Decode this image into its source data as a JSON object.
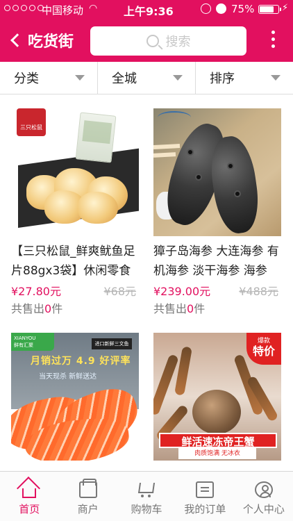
{
  "status_bar": {
    "carrier": "中国移动",
    "time": "上午9:36",
    "battery_pct": "75%"
  },
  "header": {
    "title": "吃货街",
    "search_placeholder": "搜索"
  },
  "filters": [
    {
      "label": "分类"
    },
    {
      "label": "全城"
    },
    {
      "label": "排序"
    }
  ],
  "products": [
    {
      "title": "【三只松鼠_鲜爽鱿鱼足片88gx3袋】休闲零食",
      "price": "¥27.80元",
      "old_price": "¥68元",
      "sold_prefix": "共售出",
      "sold_count": "0",
      "sold_suffix": "件",
      "image_text": "三只松鼠"
    },
    {
      "title": "獐子岛海参 大连海参 有机海参 淡干海参 海参",
      "price": "¥239.00元",
      "old_price": "¥488元",
      "sold_prefix": "共售出",
      "sold_count": "0",
      "sold_suffix": "件",
      "image_text": ""
    },
    {
      "title": "",
      "price": "",
      "old_price": "",
      "sold_prefix": "",
      "sold_count": "",
      "sold_suffix": "",
      "image_text": {
        "brand_en": "XIANYOU",
        "brand_cn": "鲜有汇聚",
        "tag": "进口新鲜三文鱼",
        "headline": "月销过万 4.9 好评率",
        "sub": "当天现杀 新鲜送达"
      }
    },
    {
      "title": "",
      "price": "",
      "old_price": "",
      "sold_prefix": "",
      "sold_count": "",
      "sold_suffix": "",
      "image_text": {
        "hot_top": "爆款",
        "hot": "特价",
        "banner": "鲜活速冻帝王蟹",
        "banner_sub": "肉质饱满 无冰衣"
      }
    }
  ],
  "tabbar": [
    {
      "label": "首页",
      "icon": "home-icon",
      "active": true
    },
    {
      "label": "商户",
      "icon": "shop-icon",
      "active": false
    },
    {
      "label": "购物车",
      "icon": "cart-icon",
      "active": false
    },
    {
      "label": "我的订单",
      "icon": "order-icon",
      "active": false
    },
    {
      "label": "个人中心",
      "icon": "user-icon",
      "active": false
    }
  ],
  "colors": {
    "accent": "#e2105f",
    "price": "#e2105f",
    "muted": "#b5b5b5"
  }
}
